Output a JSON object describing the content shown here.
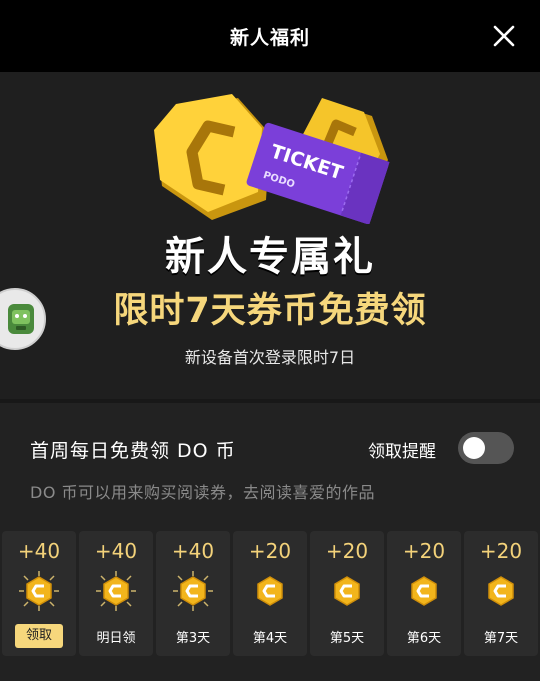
{
  "header": {
    "title": "新人福利",
    "close_icon": "close-icon"
  },
  "hero": {
    "ticket_text": "TICKET",
    "ticket_brand": "PODO",
    "heading": "新人专属礼",
    "subheading": "限时7天券币免费领",
    "note": "新设备首次登录限时7日"
  },
  "panel": {
    "title": "首周每日免费领 DO 币",
    "remind_label": "领取提醒",
    "remind_enabled": false,
    "description": "DO 币可以用来购买阅读券，去阅读喜爱的作品"
  },
  "days": [
    {
      "amount": "+40",
      "label": "领取",
      "state": "claimable"
    },
    {
      "amount": "+40",
      "label": "明日领",
      "state": "glow"
    },
    {
      "amount": "+40",
      "label": "第3天",
      "state": "glow"
    },
    {
      "amount": "+20",
      "label": "第4天",
      "state": "normal"
    },
    {
      "amount": "+20",
      "label": "第5天",
      "state": "normal"
    },
    {
      "amount": "+20",
      "label": "第6天",
      "state": "normal"
    },
    {
      "amount": "+20",
      "label": "第7天",
      "state": "normal"
    }
  ],
  "colors": {
    "accent": "#f6d77c",
    "coin": "#f2b51c",
    "ticket": "#7b3fd9",
    "background": "#222222"
  }
}
